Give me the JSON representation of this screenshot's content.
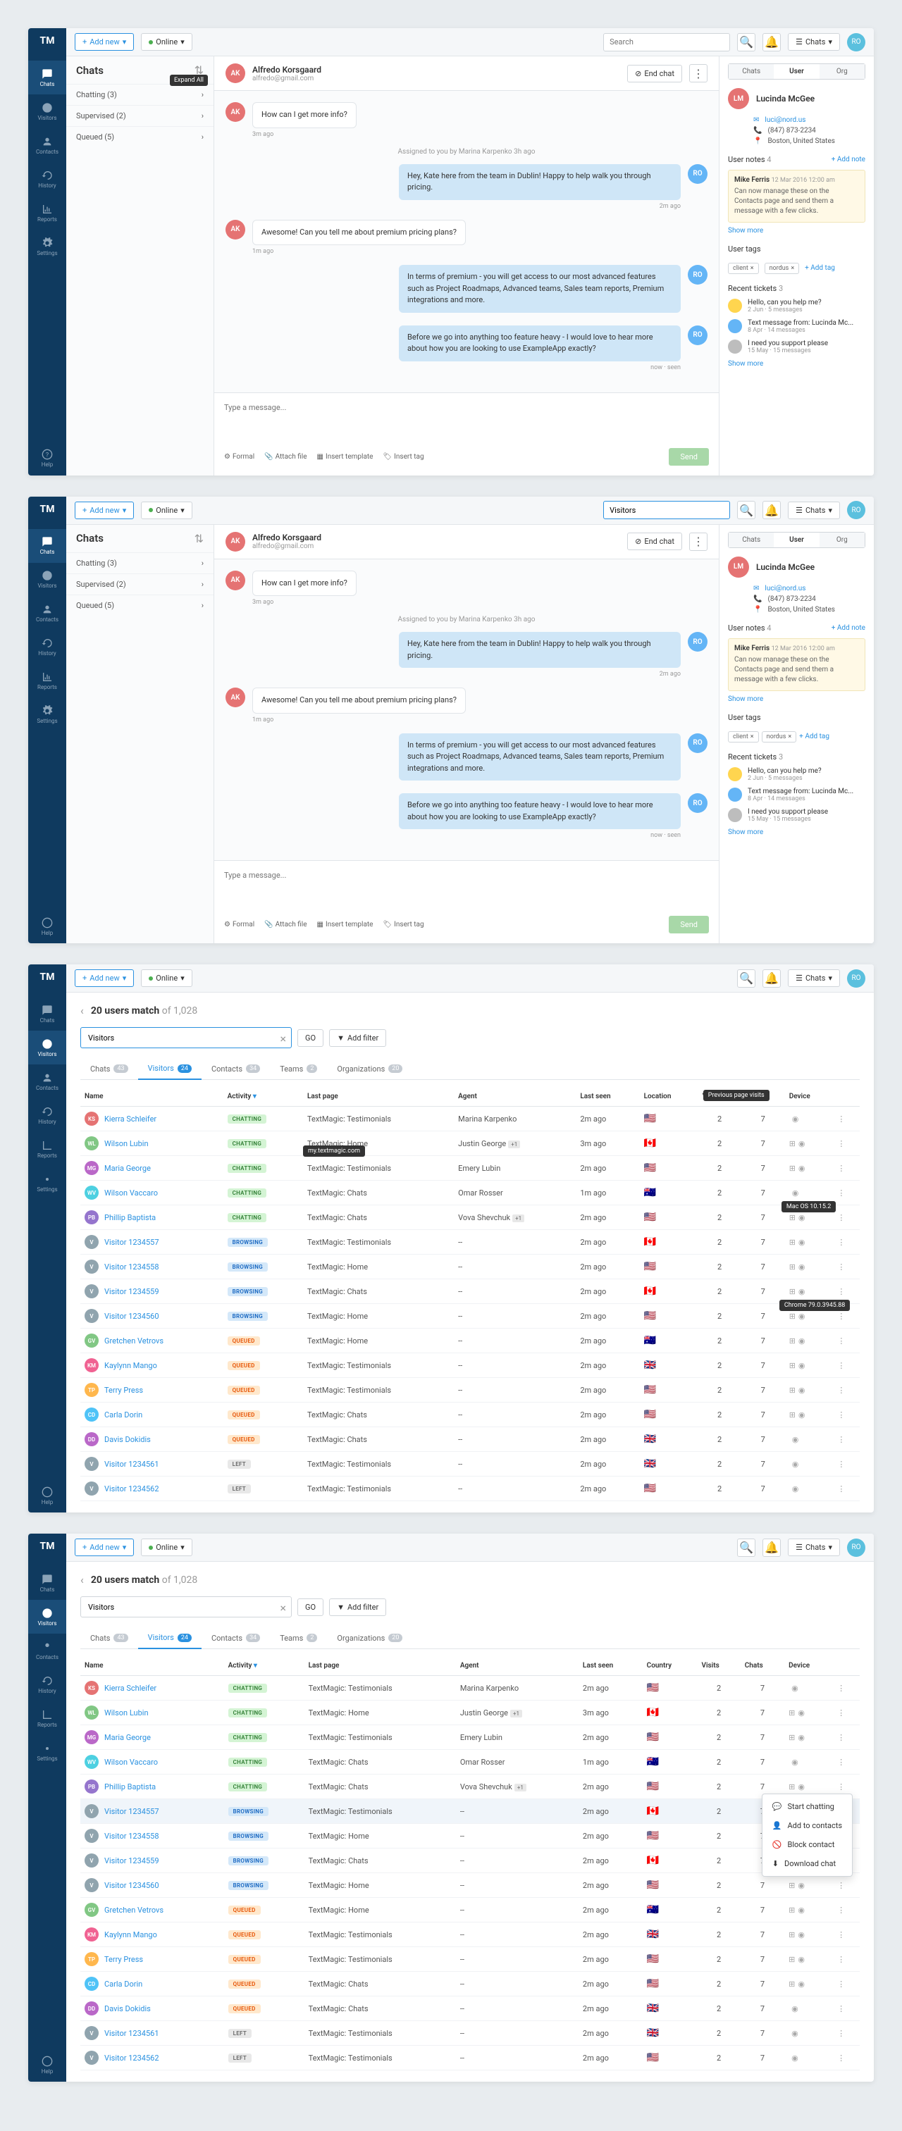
{
  "topbar": {
    "add_new": "Add new",
    "online": "Online",
    "search_placeholder": "Search",
    "chats_btn": "Chats",
    "visitors_val": "Visitors"
  },
  "nav": {
    "chats": "Chats",
    "visitors": "Visitors",
    "contacts": "Contacts",
    "history": "History",
    "reports": "Reports",
    "settings": "Settings",
    "help": "Help"
  },
  "chatlist": {
    "title": "Chats",
    "expand_tip": "Expand All",
    "cats": [
      {
        "label": "Chatting (3)"
      },
      {
        "label": "Supervised (2)"
      },
      {
        "label": "Queued (5)"
      }
    ]
  },
  "chat": {
    "name": "Alfredo Korsgaard",
    "email": "alfredo@gmail.com",
    "end_chat": "End chat",
    "msgs": [
      {
        "type": "in",
        "av": "AK",
        "text": "How can I get more info?",
        "time": "3m ago"
      },
      {
        "type": "sys",
        "text": "Assigned to you by Marina Karpenko 3h ago"
      },
      {
        "type": "out",
        "av": "RO",
        "text": "Hey, Kate here from the team in Dublin! Happy to help walk you through pricing.",
        "time": "2m ago"
      },
      {
        "type": "in",
        "av": "AK",
        "text": "Awesome! Can you tell me about premium pricing plans?",
        "time": "1m ago"
      },
      {
        "type": "out",
        "av": "RO",
        "text": "In terms of premium - you will get access to our most advanced features such as Project Roadmaps, Advanced teams, Sales team reports, Premium integrations and more.",
        "time": ""
      },
      {
        "type": "out",
        "av": "RO",
        "text": "Before we go into anything too feature heavy - I would love to hear more about how you are looking to use ExampleApp exactly?",
        "time": "now · seen"
      }
    ],
    "placeholder": "Type a message...",
    "actions": {
      "formal": "Formal",
      "attach": "Attach file",
      "template": "Insert template",
      "tag": "Insert tag",
      "send": "Send"
    }
  },
  "details": {
    "tabs": [
      "Chats",
      "User",
      "Org"
    ],
    "contact": {
      "initials": "LM",
      "name": "Lucinda McGee",
      "email": "luci@nord.us",
      "phone": "(847) 873-2234",
      "location": "Boston, United States"
    },
    "notes": {
      "title": "User notes",
      "count": "4",
      "add": "+ Add note",
      "author": "Mike Ferris",
      "date": "12 Mar 2016 12:00 am",
      "text": "Can now manage these on the Contacts page and send them a message with a few clicks.",
      "show_more": "Show more"
    },
    "tags": {
      "title": "User tags",
      "items": [
        "client",
        "nordus"
      ],
      "add": "+ Add tag"
    },
    "tickets": {
      "title": "Recent tickets",
      "count": "3",
      "items": [
        {
          "color": "#ffd54f",
          "title": "Hello, can you help me?",
          "meta": "2 Jun · 5 messages"
        },
        {
          "color": "#64b5f6",
          "title": "Text message from: Lucinda Mc...",
          "meta": "8 Apr · 14 messages"
        },
        {
          "color": "#bdbdbd",
          "title": "I need you support please",
          "meta": "15 May · 15 messages"
        }
      ],
      "show_more": "Show more"
    }
  },
  "visitors_page": {
    "title_a": "20 users match",
    "title_b": " of 1,028",
    "search_val": "Visitors",
    "go": "GO",
    "add_filter": "Add filter",
    "tabs": [
      {
        "label": "Chats",
        "n": "43"
      },
      {
        "label": "Visitors",
        "n": "24",
        "active": true
      },
      {
        "label": "Contacts",
        "n": "34"
      },
      {
        "label": "Teams",
        "n": "2"
      },
      {
        "label": "Organizations",
        "n": "20"
      }
    ],
    "cols": [
      "Name",
      "Activity",
      "Last page",
      "Agent",
      "Last seen",
      "Location",
      "Visits",
      "Chats",
      "Device"
    ],
    "cols4": [
      "Name",
      "Activity",
      "Last page",
      "Agent",
      "Last seen",
      "Country",
      "Visits",
      "Chats",
      "Device"
    ],
    "rows": [
      {
        "av": "#e57373",
        "i": "KS",
        "name": "Kierra Schleifer",
        "act": "CHATTING",
        "page": "TextMagic: Testimonials",
        "agent": "Marina Karpenko",
        "seen": "2m ago",
        "flag": "🇺🇸",
        "visits": "2",
        "chats": "7",
        "dev": "apple"
      },
      {
        "av": "#81c784",
        "i": "WL",
        "name": "Wilson Lubin",
        "act": "CHATTING",
        "page": "TextMagic: Home",
        "agent": "Justin George",
        "agent_n": "+1",
        "seen": "3m ago",
        "flag": "🇨🇦",
        "visits": "2",
        "chats": "7",
        "dev": "win"
      },
      {
        "av": "#ba68c8",
        "i": "MG",
        "name": "Maria George",
        "act": "CHATTING",
        "page": "TextMagic: Testimonials",
        "agent": "Emery Lubin",
        "seen": "2m ago",
        "flag": "🇺🇸",
        "visits": "2",
        "chats": "7",
        "dev": "win"
      },
      {
        "av": "#4dd0e1",
        "i": "WV",
        "name": "Wilson Vaccaro",
        "act": "CHATTING",
        "page": "TextMagic: Chats",
        "agent": "Omar Rosser",
        "seen": "1m ago",
        "flag": "🇦🇺",
        "visits": "2",
        "chats": "7",
        "dev": "apple"
      },
      {
        "av": "#9575cd",
        "i": "PB",
        "name": "Phillip Baptista",
        "act": "CHATTING",
        "page": "TextMagic: Chats",
        "agent": "Vova Shevchuk",
        "agent_n": "+1",
        "seen": "2m ago",
        "flag": "🇺🇸",
        "visits": "2",
        "chats": "7",
        "dev": "win"
      },
      {
        "av": "#90a4ae",
        "i": "V",
        "name": "Visitor 1234557",
        "act": "BROWSING",
        "page": "TextMagic: Testimonials",
        "agent": "--",
        "seen": "2m ago",
        "flag": "🇨🇦",
        "visits": "2",
        "chats": "7",
        "dev": "win"
      },
      {
        "av": "#90a4ae",
        "i": "V",
        "name": "Visitor 1234558",
        "act": "BROWSING",
        "page": "TextMagic: Home",
        "agent": "--",
        "seen": "2m ago",
        "flag": "🇺🇸",
        "visits": "2",
        "chats": "7",
        "dev": "win"
      },
      {
        "av": "#90a4ae",
        "i": "V",
        "name": "Visitor 1234559",
        "act": "BROWSING",
        "page": "TextMagic: Chats",
        "agent": "--",
        "seen": "2m ago",
        "flag": "🇨🇦",
        "visits": "2",
        "chats": "7",
        "dev": "win"
      },
      {
        "av": "#90a4ae",
        "i": "V",
        "name": "Visitor 1234560",
        "act": "BROWSING",
        "page": "TextMagic: Home",
        "agent": "--",
        "seen": "2m ago",
        "flag": "🇺🇸",
        "visits": "2",
        "chats": "7",
        "dev": "win"
      },
      {
        "av": "#81c784",
        "i": "GV",
        "name": "Gretchen Vetrovs",
        "act": "QUEUED",
        "page": "TextMagic: Home",
        "agent": "--",
        "seen": "2m ago",
        "flag": "🇦🇺",
        "visits": "2",
        "chats": "7",
        "dev": "win"
      },
      {
        "av": "#f06292",
        "i": "KM",
        "name": "Kaylynn Mango",
        "act": "QUEUED",
        "page": "TextMagic: Testimonials",
        "agent": "--",
        "seen": "2m ago",
        "flag": "🇬🇧",
        "visits": "2",
        "chats": "7",
        "dev": "win"
      },
      {
        "av": "#ffb74d",
        "i": "TP",
        "name": "Terry Press",
        "act": "QUEUED",
        "page": "TextMagic: Testimonials",
        "agent": "--",
        "seen": "2m ago",
        "flag": "🇺🇸",
        "visits": "2",
        "chats": "7",
        "dev": "win"
      },
      {
        "av": "#4fc3f7",
        "i": "CD",
        "name": "Carla Dorin",
        "act": "QUEUED",
        "page": "TextMagic: Chats",
        "agent": "--",
        "seen": "2m ago",
        "flag": "🇺🇸",
        "visits": "2",
        "chats": "7",
        "dev": "win"
      },
      {
        "av": "#ba68c8",
        "i": "DD",
        "name": "Davis Dokidis",
        "act": "QUEUED",
        "page": "TextMagic: Chats",
        "agent": "--",
        "seen": "2m ago",
        "flag": "🇬🇧",
        "visits": "2",
        "chats": "7",
        "dev": "apple"
      },
      {
        "av": "#90a4ae",
        "i": "V",
        "name": "Visitor 1234561",
        "act": "LEFT",
        "page": "TextMagic: Testimonials",
        "agent": "--",
        "seen": "2m ago",
        "flag": "🇬🇧",
        "visits": "2",
        "chats": "7",
        "dev": "apple"
      },
      {
        "av": "#90a4ae",
        "i": "V",
        "name": "Visitor 1234562",
        "act": "LEFT",
        "page": "TextMagic: Testimonials",
        "agent": "--",
        "seen": "2m ago",
        "flag": "🇺🇸",
        "visits": "2",
        "chats": "7",
        "dev": "apple"
      }
    ],
    "tooltips": {
      "visits": "Previous page visits",
      "url": "my.textmagic.com",
      "mac": "Mac OS 10.15.2",
      "chrome": "Chrome 79.0.3945.88"
    },
    "ctx": [
      "Start chatting",
      "Add to contacts",
      "Block contact",
      "Download chat"
    ]
  },
  "logo": "TM"
}
